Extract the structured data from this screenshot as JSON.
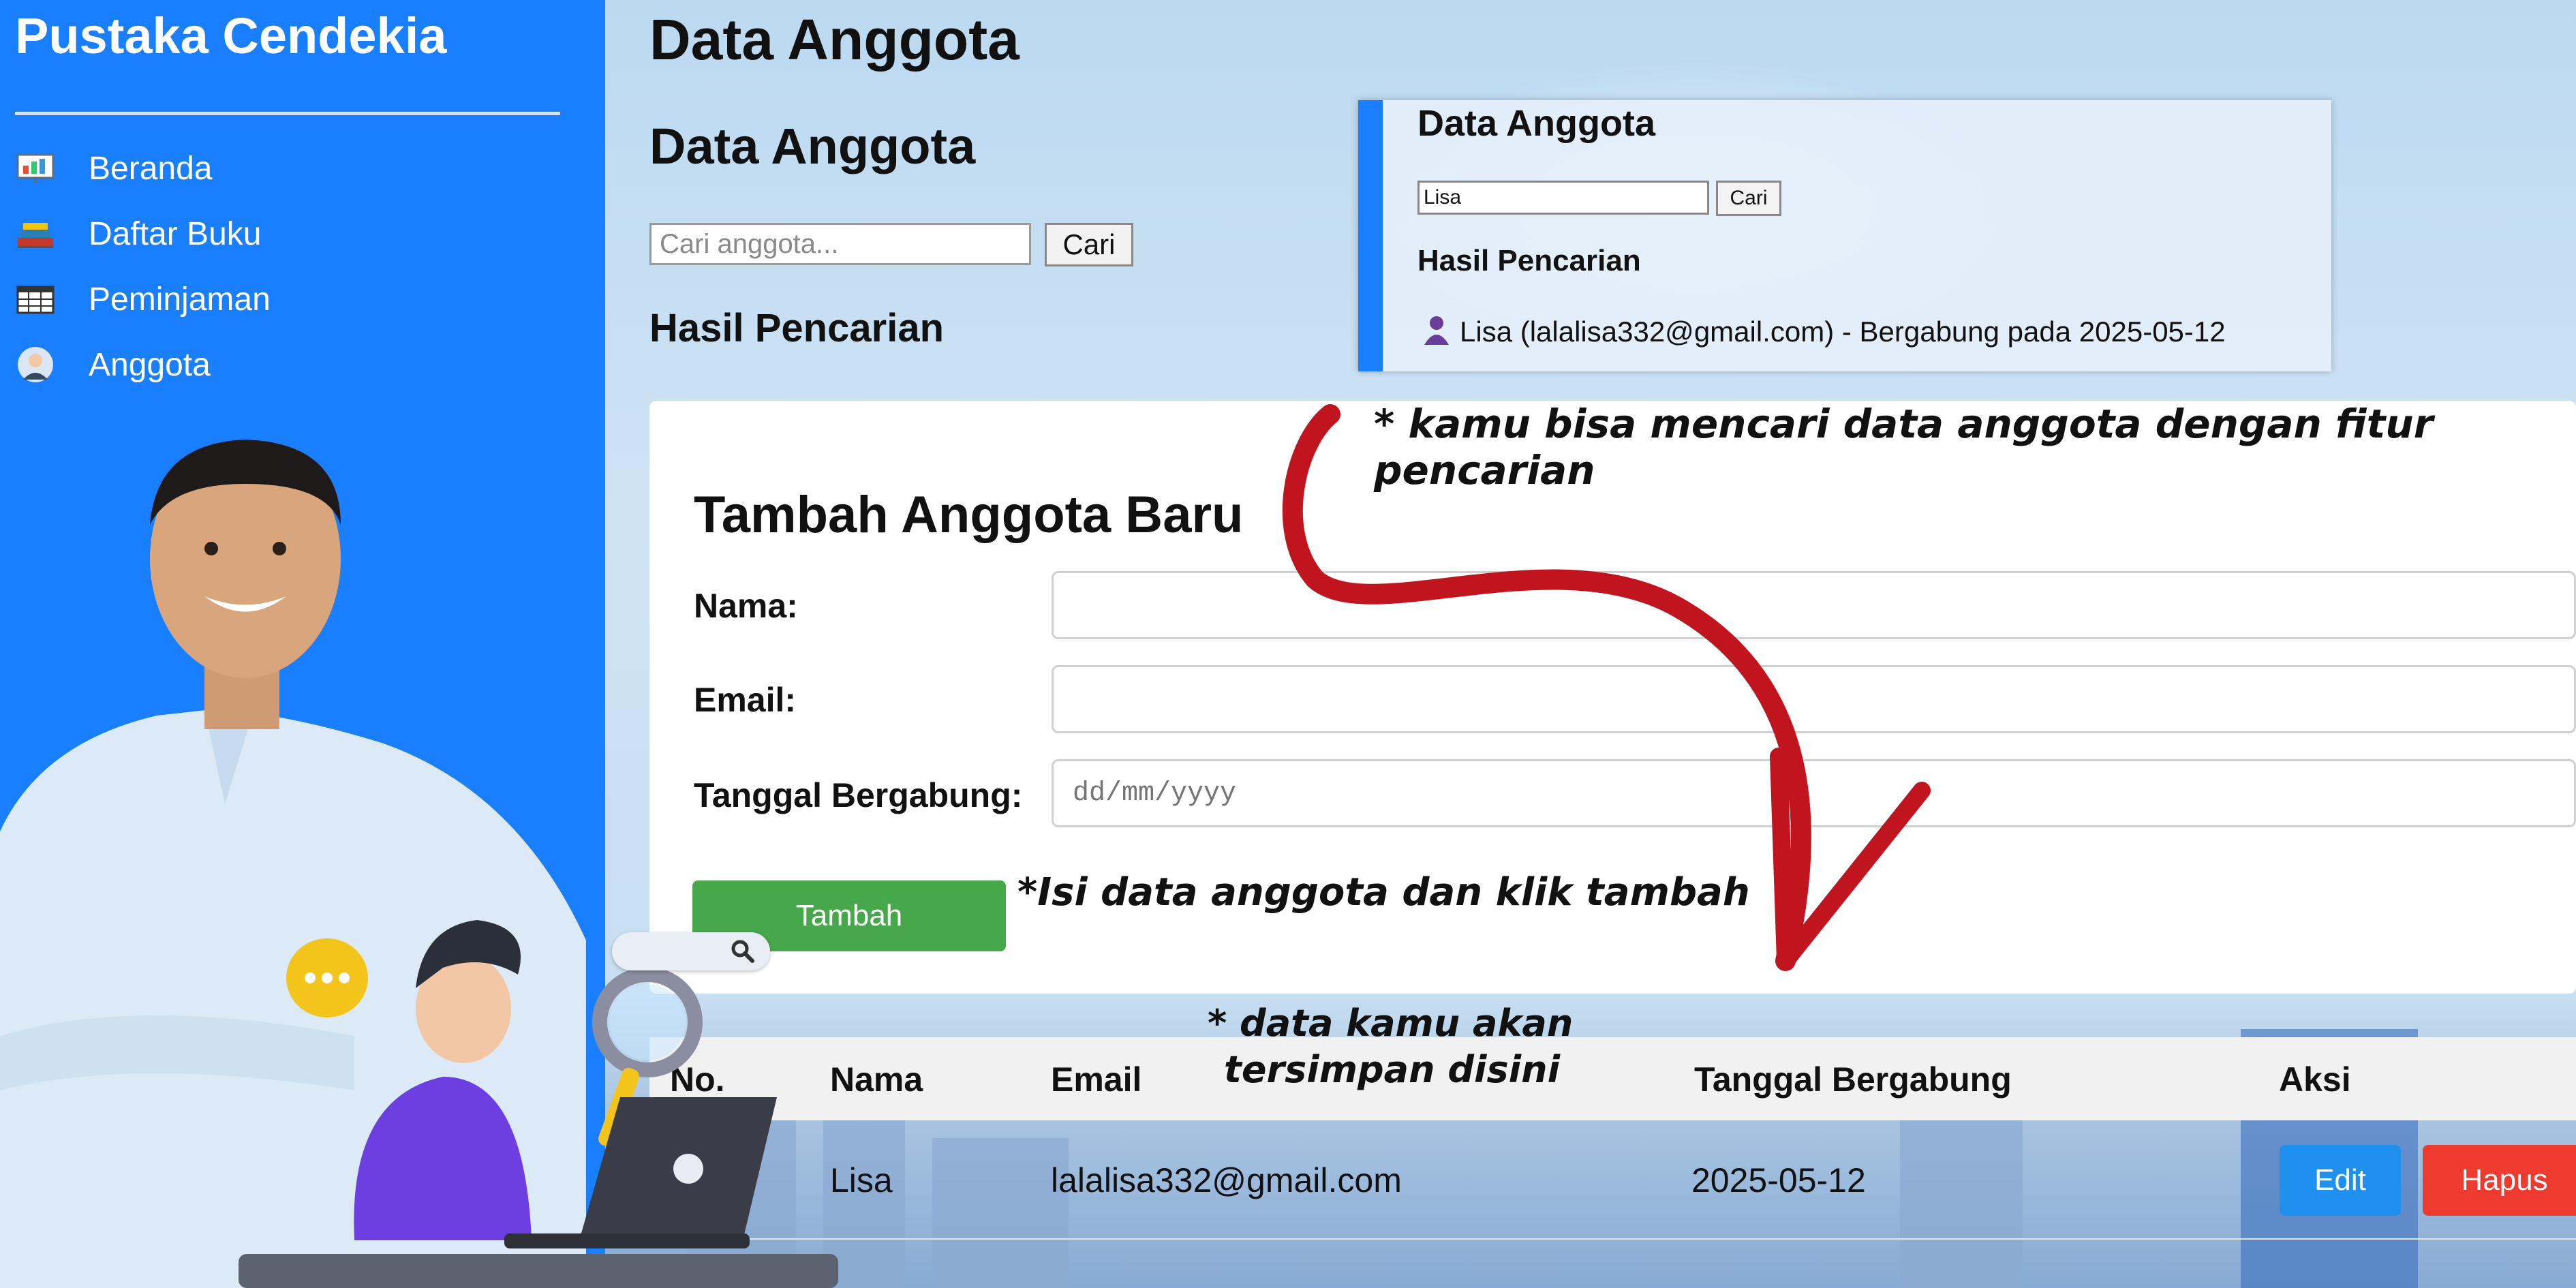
{
  "sidebar": {
    "brand": "Pustaka Cendekia",
    "items": [
      {
        "label": "Beranda",
        "icon": "presentation-board-icon"
      },
      {
        "label": "Daftar Buku",
        "icon": "books-icon"
      },
      {
        "label": "Peminjaman",
        "icon": "table-grid-icon"
      },
      {
        "label": "Anggota",
        "icon": "user-avatar-icon"
      }
    ]
  },
  "page": {
    "title": "Data Anggota",
    "section_title": "Data Anggota",
    "search_placeholder": "Cari anggota...",
    "search_button": "Cari",
    "results_title": "Hasil Pencarian"
  },
  "callout": {
    "title": "Data Anggota",
    "search_value": "Lisa",
    "search_button": "Cari",
    "results_title": "Hasil Pencarian",
    "result_text": "Lisa (lalalisa332@gmail.com) - Bergabung pada 2025-05-12",
    "result_icon": "person-icon"
  },
  "form": {
    "title": "Tambah Anggota Baru",
    "name_label": "Nama:",
    "email_label": "Email:",
    "date_label": "Tanggal Bergabung:",
    "date_placeholder": "dd/mm/yyyy",
    "add_button": "Tambah"
  },
  "table": {
    "headers": [
      "No.",
      "Nama",
      "Email",
      "Tanggal Bergabung",
      "Aksi"
    ],
    "rows": [
      {
        "no": "",
        "nama": "Lisa",
        "email": "lalalisa332@gmail.com",
        "tanggal": "2025-05-12"
      }
    ],
    "edit_button": "Edit",
    "delete_button": "Hapus"
  },
  "annotations": {
    "search_note": "* kamu bisa mencari data anggota dengan fitur pencarian",
    "form_note": "*Isi data anggota dan klik tambah",
    "table_note_line1": "* data kamu akan",
    "table_note_line2": "tersimpan disini"
  },
  "colors": {
    "sidebar": "#1a7fff",
    "add_button": "#46a84a",
    "edit_button": "#1f8ff0",
    "delete_button": "#ef3b2f",
    "arrow": "#c0151f"
  }
}
